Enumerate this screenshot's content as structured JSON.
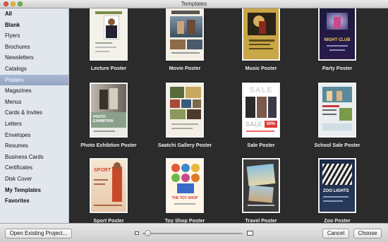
{
  "window": {
    "title": "Templates"
  },
  "sidebar": {
    "items": [
      {
        "label": "All",
        "bold": true,
        "selected": false
      },
      {
        "label": "Blank",
        "bold": true,
        "selected": false
      },
      {
        "label": "Flyers",
        "bold": false,
        "selected": false
      },
      {
        "label": "Brochures",
        "bold": false,
        "selected": false
      },
      {
        "label": "Newsletters",
        "bold": false,
        "selected": false
      },
      {
        "label": "Catalogs",
        "bold": false,
        "selected": false
      },
      {
        "label": "Posters",
        "bold": false,
        "selected": true
      },
      {
        "label": "Magazines",
        "bold": false,
        "selected": false
      },
      {
        "label": "Menus",
        "bold": false,
        "selected": false
      },
      {
        "label": "Cards & Invites",
        "bold": false,
        "selected": false
      },
      {
        "label": "Letters",
        "bold": false,
        "selected": false
      },
      {
        "label": "Envelopes",
        "bold": false,
        "selected": false
      },
      {
        "label": "Resumes",
        "bold": false,
        "selected": false
      },
      {
        "label": "Business Cards",
        "bold": false,
        "selected": false
      },
      {
        "label": "Certificates",
        "bold": false,
        "selected": false
      },
      {
        "label": "Disk Cover",
        "bold": false,
        "selected": false
      },
      {
        "label": "My Templates",
        "bold": true,
        "selected": false
      },
      {
        "label": "Favorites",
        "bold": true,
        "selected": false
      }
    ]
  },
  "templates": [
    {
      "label": "Lecture Poster",
      "art": "lecture"
    },
    {
      "label": "Movie Poster",
      "art": "movie"
    },
    {
      "label": "Music Poster",
      "art": "music"
    },
    {
      "label": "Party Poster",
      "art": "party",
      "text": "NIGHT CLUB"
    },
    {
      "label": "Photo Exhibtion Poster",
      "art": "photo",
      "text": "PHOTO EXHIBITION"
    },
    {
      "label": "Saatchi Gallery Poster",
      "art": "gallery"
    },
    {
      "label": "Sale Poster",
      "art": "sale",
      "text": "SALE",
      "text2": "50%"
    },
    {
      "label": "School Sale Poster",
      "art": "school"
    },
    {
      "label": "Sport Poster",
      "art": "sport",
      "text": "SPORT"
    },
    {
      "label": "Toy Shop Poster",
      "art": "toy",
      "text": "THE TOY SHOP"
    },
    {
      "label": "Travel Poster",
      "art": "travel"
    },
    {
      "label": "Zoo Poster",
      "art": "zoo",
      "text": "ZOO LIGHTS"
    }
  ],
  "footer": {
    "open_existing_label": "Open Existing Project...",
    "cancel_label": "Cancel",
    "choose_label": "Choose",
    "zoom_level": 0.05
  }
}
